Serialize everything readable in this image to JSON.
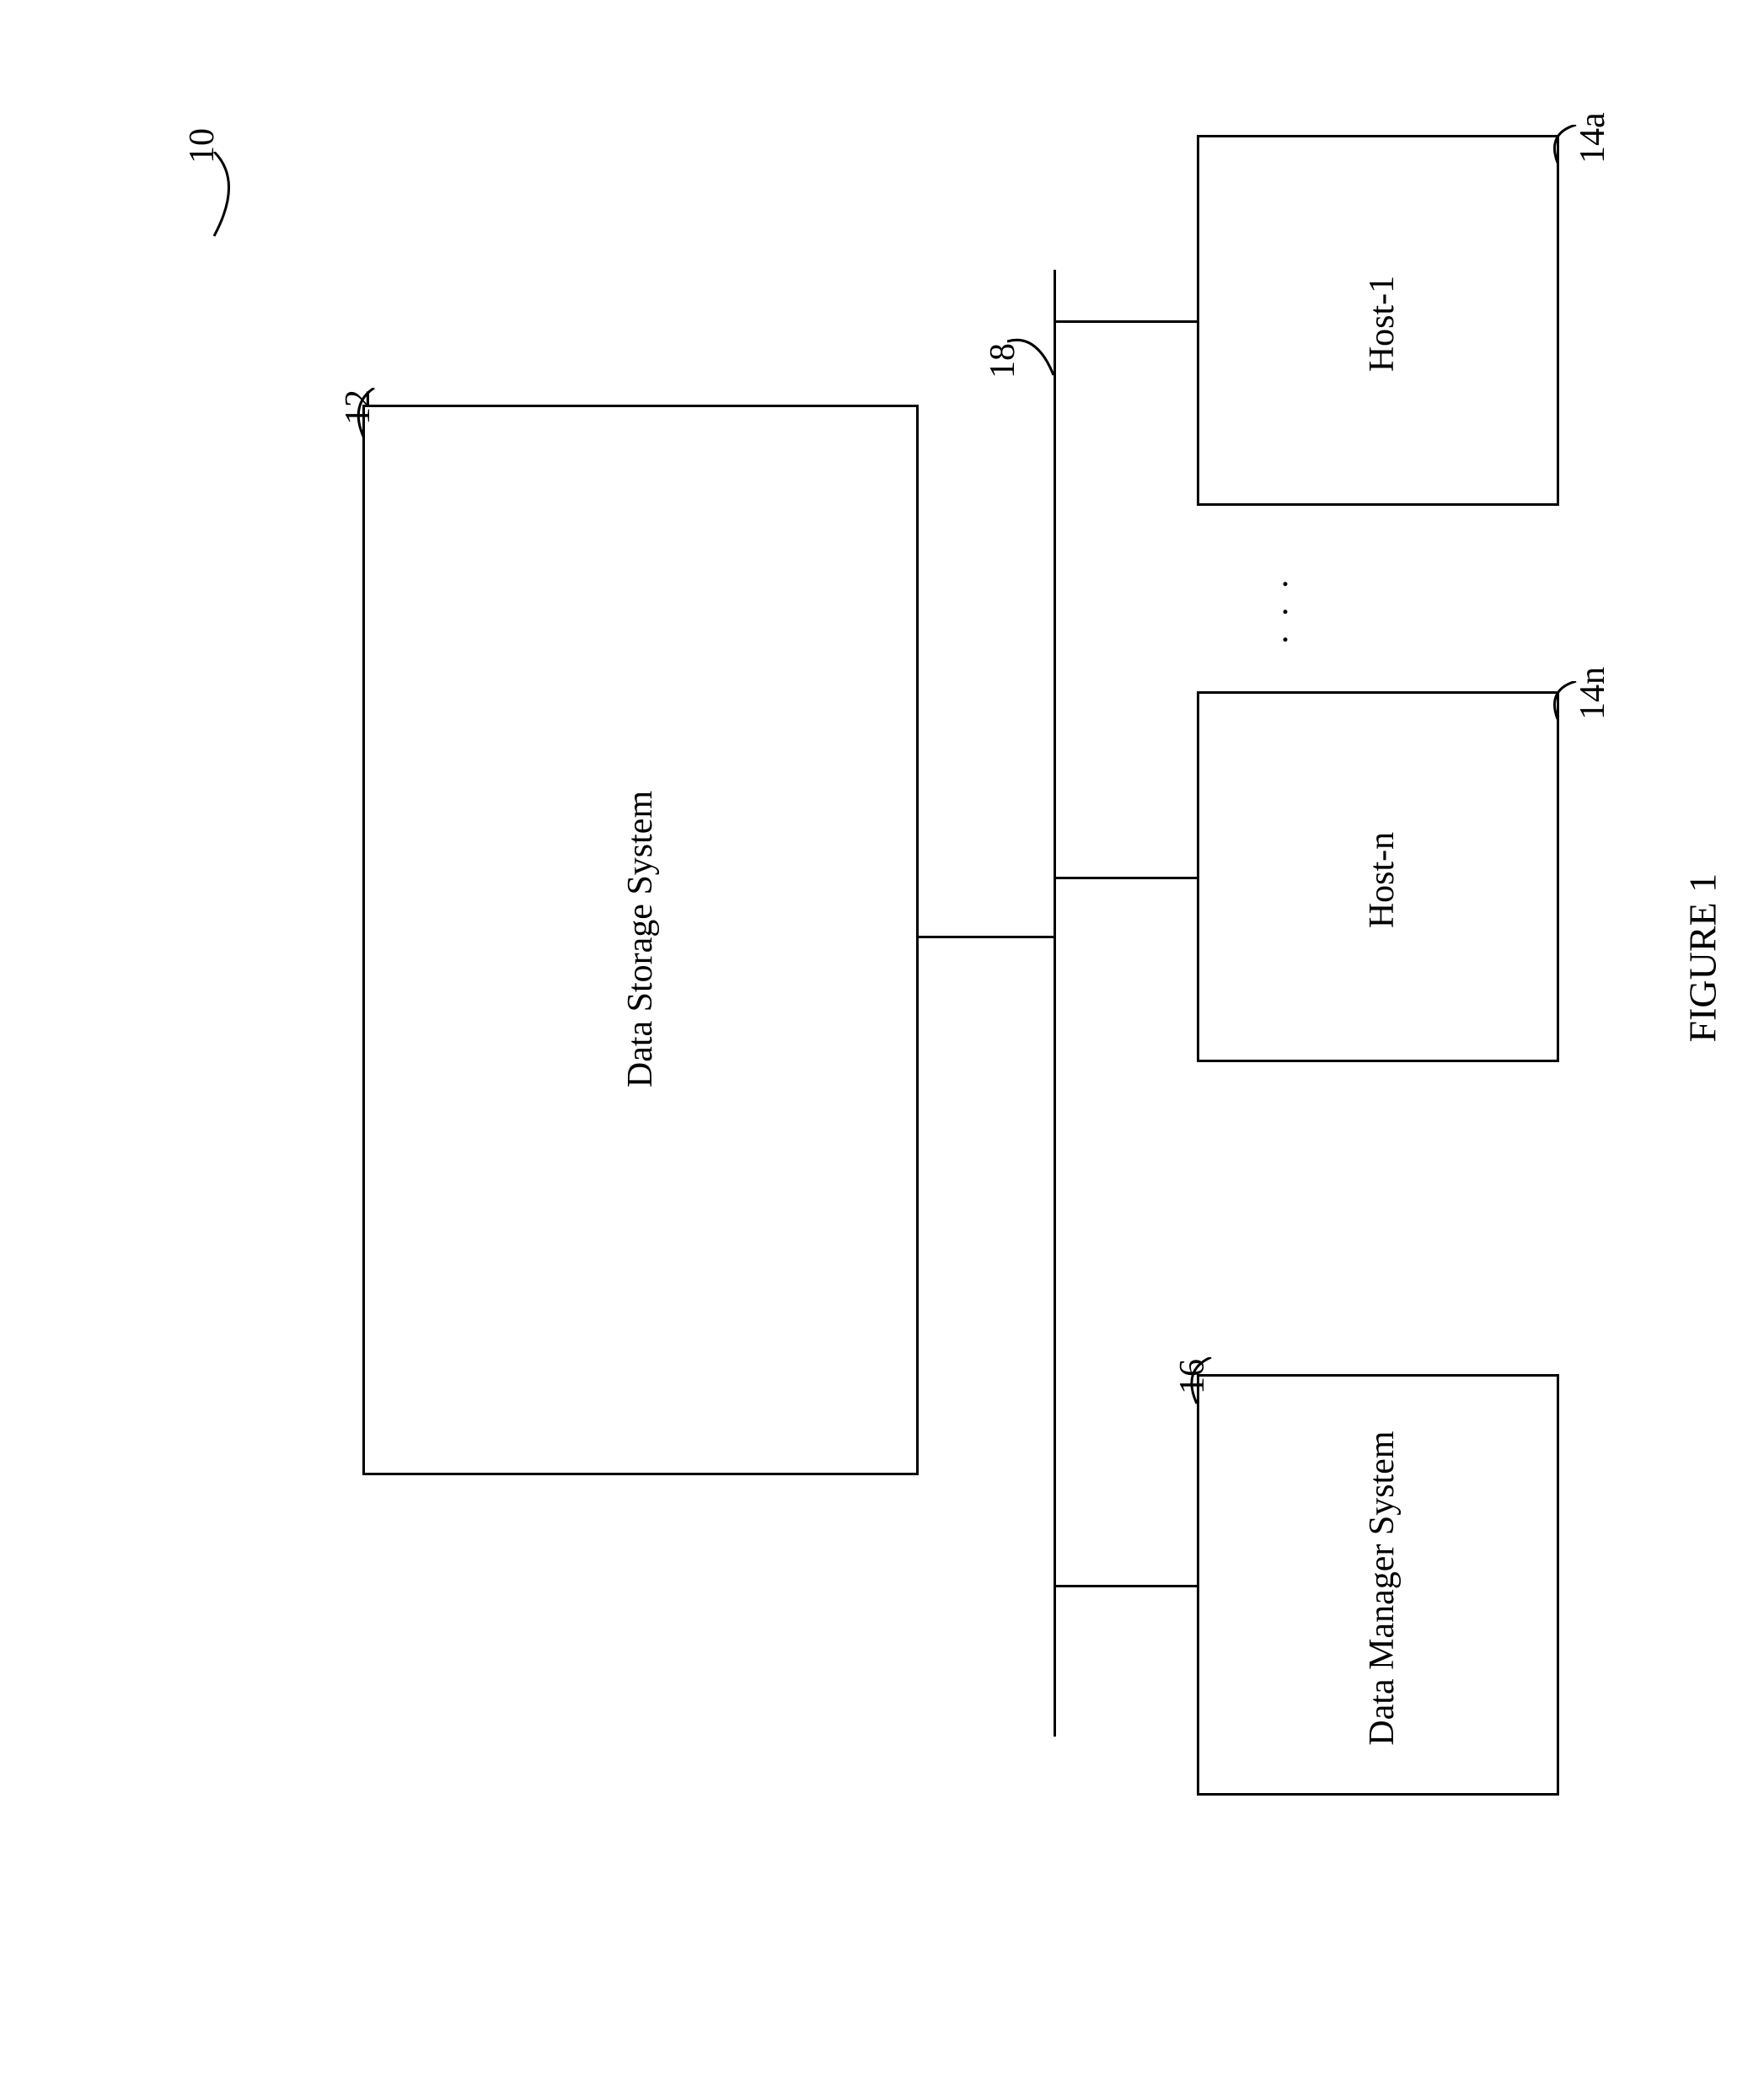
{
  "figure": {
    "caption": "FIGURE 1",
    "diagramRef": "10"
  },
  "blocks": {
    "storage": {
      "label": "Data Storage System",
      "ref": "12"
    },
    "bus": {
      "ref": "18"
    },
    "host1": {
      "label": "Host-1",
      "ref": "14a"
    },
    "hostn": {
      "label": "Host-n",
      "ref": "14n"
    },
    "manager": {
      "label": "Data Manager System",
      "ref": "16"
    }
  },
  "misc": {
    "ellipsis": ". . ."
  }
}
